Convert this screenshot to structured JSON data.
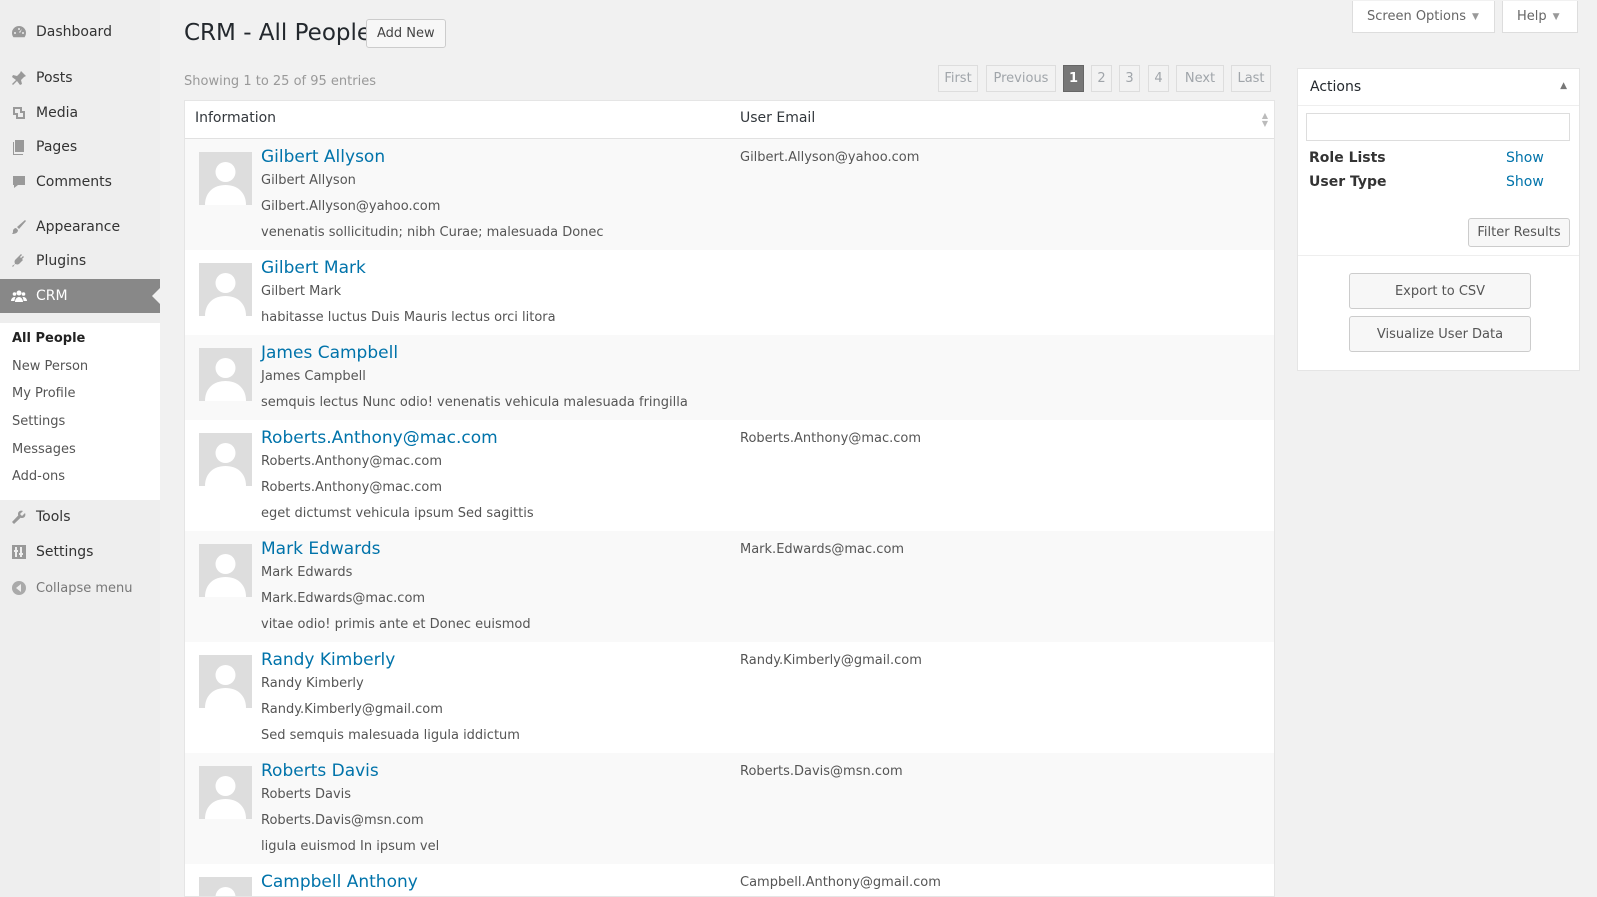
{
  "sidebar": {
    "items": [
      {
        "label": "Dashboard",
        "icon": "dashboard-icon"
      },
      {
        "label": "Posts",
        "icon": "pin-icon"
      },
      {
        "label": "Media",
        "icon": "media-icon"
      },
      {
        "label": "Pages",
        "icon": "pages-icon"
      },
      {
        "label": "Comments",
        "icon": "comment-icon"
      },
      {
        "label": "Appearance",
        "icon": "brush-icon"
      },
      {
        "label": "Plugins",
        "icon": "plug-icon"
      },
      {
        "label": "CRM",
        "icon": "groups-icon"
      },
      {
        "label": "Tools",
        "icon": "wrench-icon"
      },
      {
        "label": "Settings",
        "icon": "sliders-icon"
      }
    ],
    "submenu": [
      "All People",
      "New Person",
      "My Profile",
      "Settings",
      "Messages",
      "Add-ons"
    ],
    "collapse_label": "Collapse menu"
  },
  "header": {
    "title": "CRM - All People",
    "add_new": "Add New",
    "screen_options": "Screen Options",
    "help": "Help"
  },
  "entries_text": "Showing 1 to 25 of 95 entries",
  "pagination": {
    "first": "First",
    "previous": "Previous",
    "pages": [
      "1",
      "2",
      "3",
      "4"
    ],
    "current": "1",
    "next": "Next",
    "last": "Last"
  },
  "table": {
    "columns": [
      "Information",
      "User Email"
    ],
    "rows": [
      {
        "name": "Gilbert Allyson",
        "lines": [
          "Gilbert Allyson",
          "Gilbert.Allyson@yahoo.com",
          "venenatis sollicitudin; nibh Curae; malesuada Donec"
        ],
        "email": "Gilbert.Allyson@yahoo.com"
      },
      {
        "name": "Gilbert Mark",
        "lines": [
          "Gilbert Mark",
          "habitasse luctus Duis Mauris lectus orci litora"
        ],
        "email": ""
      },
      {
        "name": "James Campbell",
        "lines": [
          "James Campbell",
          "semquis lectus Nunc odio! venenatis vehicula malesuada fringilla"
        ],
        "email": ""
      },
      {
        "name": "Roberts.Anthony@mac.com",
        "lines": [
          "Roberts.Anthony@mac.com",
          "Roberts.Anthony@mac.com",
          "eget dictumst vehicula ipsum Sed sagittis"
        ],
        "email": "Roberts.Anthony@mac.com"
      },
      {
        "name": "Mark Edwards",
        "lines": [
          "Mark Edwards",
          "Mark.Edwards@mac.com",
          "vitae odio! primis ante et Donec euismod"
        ],
        "email": "Mark.Edwards@mac.com"
      },
      {
        "name": "Randy Kimberly",
        "lines": [
          "Randy Kimberly",
          "Randy.Kimberly@gmail.com",
          "Sed semquis malesuada ligula iddictum"
        ],
        "email": "Randy.Kimberly@gmail.com"
      },
      {
        "name": "Roberts Davis",
        "lines": [
          "Roberts Davis",
          "Roberts.Davis@msn.com",
          "ligula euismod In ipsum vel"
        ],
        "email": "Roberts.Davis@msn.com"
      },
      {
        "name": "Campbell Anthony",
        "lines": [],
        "email": "Campbell.Anthony@gmail.com"
      }
    ]
  },
  "actions": {
    "title": "Actions",
    "search_value": "",
    "filters": [
      {
        "label": "Role Lists",
        "link": "Show"
      },
      {
        "label": "User Type",
        "link": "Show"
      }
    ],
    "filter_button": "Filter Results",
    "export_button": "Export to CSV",
    "visualize_button": "Visualize User Data"
  },
  "colors": {
    "link": "#0073aa",
    "active_menu": "#888888",
    "sidebar_bg": "#eeeeee"
  }
}
